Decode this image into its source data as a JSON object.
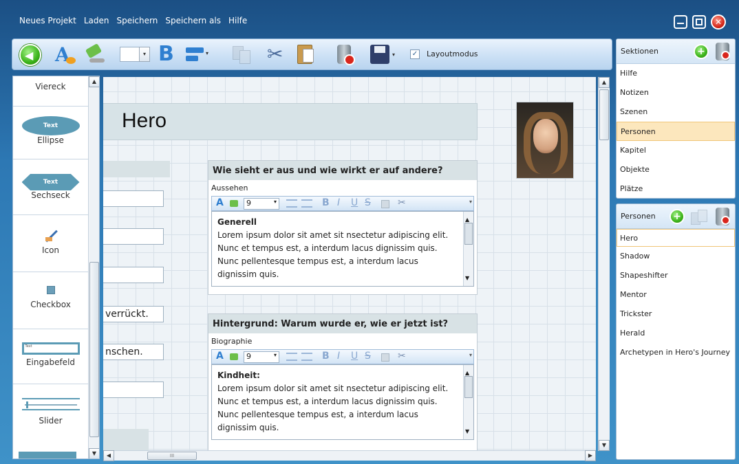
{
  "menu": {
    "items": [
      "Neues Projekt",
      "Laden",
      "Speichern",
      "Speichern als",
      "Hilfe"
    ]
  },
  "toolbar": {
    "font_size": "",
    "layout_mode_label": "Layoutmodus",
    "layout_mode_checked": true
  },
  "palette": {
    "items": [
      {
        "label": "Viereck"
      },
      {
        "label": "Ellipse",
        "shape_text": "Text"
      },
      {
        "label": "Sechseck",
        "shape_text": "Text"
      },
      {
        "label": "Icon"
      },
      {
        "label": "Checkbox"
      },
      {
        "label": "Eingabefeld",
        "shape_text": "Text"
      },
      {
        "label": "Slider"
      }
    ]
  },
  "canvas": {
    "title": "Hero",
    "partial_fields": [
      "",
      "",
      "",
      "verrückt.",
      "nschen.",
      ""
    ],
    "section1": {
      "title": "Wie sieht er aus und wie wirkt er auf andere?",
      "label": "Aussehen",
      "font_size": "9",
      "heading": "Generell",
      "body": "Lorem ipsum dolor sit amet sit nsectetur adipiscing elit. Nunc et tempus est, a interdum lacus dignissim quis. Nunc pellentesque tempus est, a interdum lacus dignissim quis."
    },
    "section2": {
      "title": "Hintergrund: Warum wurde er, wie er jetzt ist?",
      "label": "Biographie",
      "font_size": "9",
      "heading": "Kindheit:",
      "body": "Lorem ipsum dolor sit amet sit nsectetur adipiscing elit. Nunc et tempus est, a interdum lacus dignissim quis. Nunc pellentesque tempus est, a interdum lacus dignissim quis."
    },
    "hscroll_grip": "III"
  },
  "sektionen": {
    "title": "Sektionen",
    "items": [
      "Hilfe",
      "Notizen",
      "Szenen",
      "Personen",
      "Kapitel",
      "Objekte",
      "Plätze"
    ],
    "selected": "Personen"
  },
  "personen": {
    "title": "Personen",
    "items": [
      "Hero",
      "Shadow",
      "Shapeshifter",
      "Mentor",
      "Trickster",
      "Herald",
      "Archetypen in Hero's Journey"
    ],
    "selected": "Hero"
  },
  "colors": {
    "accent": "#2d78b4",
    "selection": "#fce7bd",
    "shape_fill": "#5b9bb5"
  }
}
